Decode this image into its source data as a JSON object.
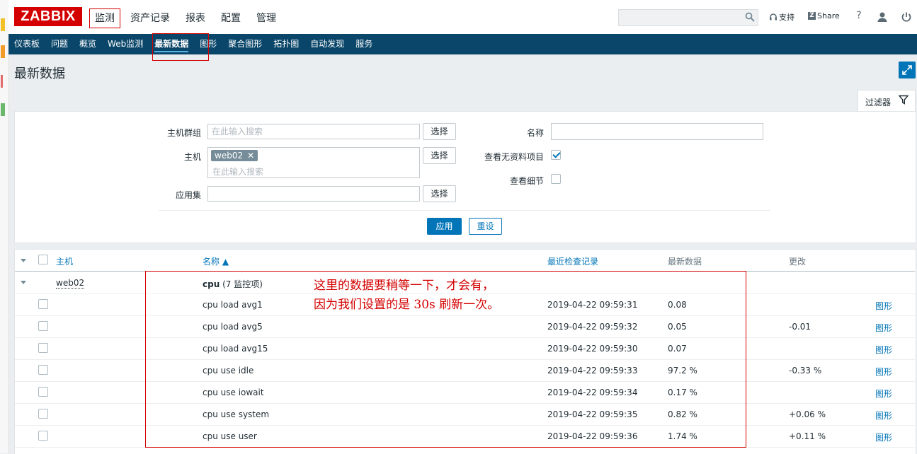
{
  "app": {
    "logo": "ZABBIX"
  },
  "top_menu": {
    "items": [
      "监测",
      "资产记录",
      "报表",
      "配置",
      "管理"
    ],
    "selected": "监测"
  },
  "top_right": {
    "search_value": "",
    "support_label": "支持",
    "share_label": "Share",
    "help_icon": "?",
    "user_icon": "user-icon",
    "logout_icon": "power-icon"
  },
  "nav": {
    "items": [
      "仪表板",
      "问题",
      "概览",
      "Web监测",
      "最新数据",
      "图形",
      "聚合图形",
      "拓扑图",
      "自动发现",
      "服务"
    ],
    "selected": "最新数据"
  },
  "page": {
    "title": "最新数据"
  },
  "filter": {
    "tab_label": "过滤器",
    "host_group_label": "主机群组",
    "host_group_placeholder": "在此输入搜索",
    "host_label": "主机",
    "host_tag": "web02",
    "host_placeholder": "在此输入搜索",
    "app_label": "应用集",
    "app_value": "",
    "select_label": "选择",
    "name_label": "名称",
    "name_value": "",
    "show_no_data_label": "查看无资料项目",
    "show_no_data_checked": true,
    "show_details_label": "查看细节",
    "show_details_checked": false,
    "apply_label": "应用",
    "reset_label": "重设"
  },
  "table": {
    "headers": {
      "host": "主机",
      "name": "名称 ▲",
      "last_check": "最近检查记录",
      "last_value": "最新数据",
      "change": "更改"
    },
    "host_row": {
      "host": "web02",
      "app": "cpu",
      "app_count": "(7 监控项)"
    },
    "rows": [
      {
        "name": "cpu load avg1",
        "last_check": "2019-04-22 09:59:31",
        "last_value": "0.08",
        "change": "",
        "action": "图形"
      },
      {
        "name": "cpu load avg5",
        "last_check": "2019-04-22 09:59:32",
        "last_value": "0.05",
        "change": "-0.01",
        "action": "图形"
      },
      {
        "name": "cpu load avg15",
        "last_check": "2019-04-22 09:59:30",
        "last_value": "0.07",
        "change": "",
        "action": "图形"
      },
      {
        "name": "cpu use idle",
        "last_check": "2019-04-22 09:59:33",
        "last_value": "97.2 %",
        "change": "-0.33 %",
        "action": "图形"
      },
      {
        "name": "cpu use iowait",
        "last_check": "2019-04-22 09:59:34",
        "last_value": "0.17 %",
        "change": "",
        "action": "图形"
      },
      {
        "name": "cpu use system",
        "last_check": "2019-04-22 09:59:35",
        "last_value": "0.82 %",
        "change": "+0.06 %",
        "action": "图形"
      },
      {
        "name": "cpu use user",
        "last_check": "2019-04-22 09:59:36",
        "last_value": "1.74 %",
        "change": "+0.11 %",
        "action": "图形"
      }
    ]
  },
  "annotation": {
    "line1": "这里的数据要稍等一下，才会有，",
    "line2": "因为我们设置的是 30s 刷新一次。"
  },
  "colors": {
    "brand_red": "#d40000",
    "nav_bg": "#0a466a",
    "accent_blue": "#0275b8"
  }
}
